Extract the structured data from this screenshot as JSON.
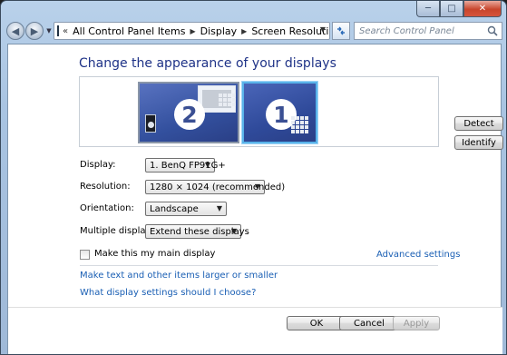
{
  "titlebar": {
    "minimize": "─",
    "maximize": "□",
    "close": "✕"
  },
  "nav": {
    "back": "◀",
    "forward": "▶",
    "overflow": "«",
    "breadcrumbs": [
      "All Control Panel Items",
      "Display",
      "Screen Resolution"
    ],
    "search_placeholder": "Search Control Panel"
  },
  "main": {
    "title": "Change the appearance of your displays",
    "monitors": [
      {
        "number": "2",
        "selected": false
      },
      {
        "number": "1",
        "selected": true
      }
    ],
    "detect_label": "Detect",
    "identify_label": "Identify",
    "settings": [
      {
        "label": "Display:",
        "value": "1. BenQ FP91G+"
      },
      {
        "label": "Resolution:",
        "value": "1280 × 1024 (recommended)"
      },
      {
        "label": "Orientation:",
        "value": "Landscape"
      },
      {
        "label": "Multiple displays:",
        "value": "Extend these displays"
      }
    ],
    "main_display_checkbox": {
      "label": "Make this my main display",
      "checked": false
    },
    "advanced_settings_link": "Advanced settings",
    "links": [
      "Make text and other items larger or smaller",
      "What display settings should I choose?"
    ]
  },
  "footer": {
    "ok_label": "OK",
    "cancel_label": "Cancel",
    "apply_label": "Apply",
    "apply_enabled": false
  },
  "colors": {
    "accent_blue": "#1e3287",
    "link_blue": "#1a5fb4",
    "selected_monitor_border": "#59b3ea"
  }
}
